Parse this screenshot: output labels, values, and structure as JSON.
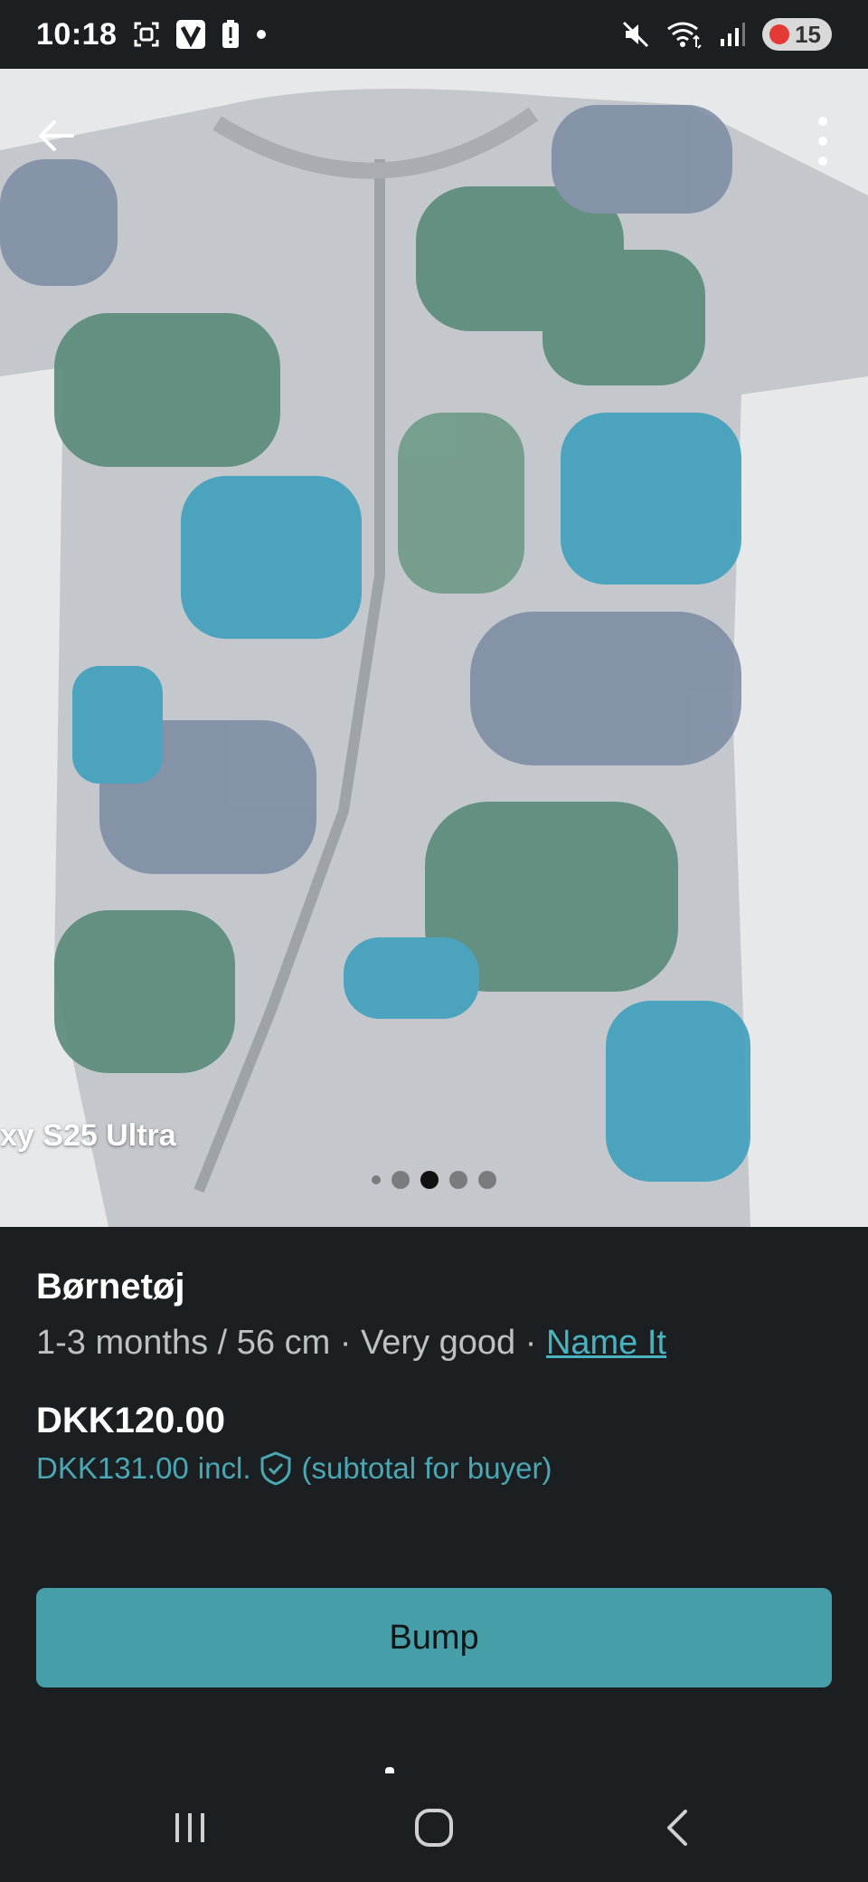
{
  "status_bar": {
    "time": "10:18",
    "battery": "15",
    "icons": [
      "screenshot-icon",
      "v-app-icon",
      "battery-alert-icon",
      "notification-dot-icon",
      "mute-icon",
      "wifi-icon",
      "signal-icon"
    ]
  },
  "photo": {
    "watermark": "xy S25 Ultra",
    "image_count": 5,
    "active_index": 2
  },
  "item": {
    "title": "Børnetøj",
    "size": "1-3 months / 56 cm",
    "sep1": " · ",
    "condition": "Very good",
    "sep2": " · ",
    "brand": "Name It",
    "price": "DKK120.00",
    "buyer_price": "DKK131.00",
    "incl": "incl.",
    "subtotal_note": "(subtotal for buyer)"
  },
  "actions": {
    "bump_label": "Bump"
  },
  "colors": {
    "accent": "#459ea8",
    "link": "#4ab3c0",
    "background": "#1b1f21"
  }
}
